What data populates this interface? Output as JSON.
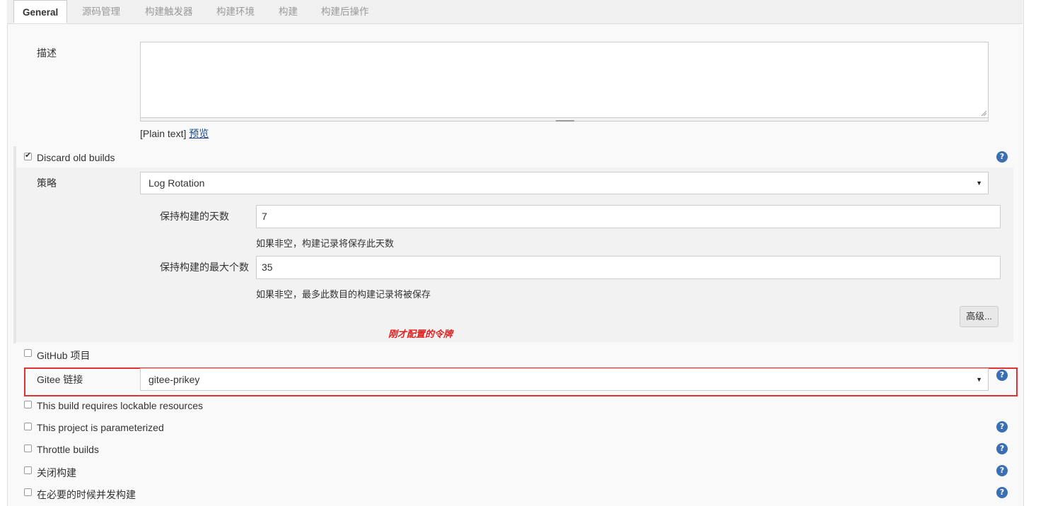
{
  "tabs": [
    {
      "label": "General",
      "active": true
    },
    {
      "label": "源码管理"
    },
    {
      "label": "构建触发器"
    },
    {
      "label": "构建环境"
    },
    {
      "label": "构建"
    },
    {
      "label": "构建后操作"
    }
  ],
  "description": {
    "label": "描述",
    "value": "",
    "format_label": "[Plain text]",
    "preview_link": "预览"
  },
  "discard_old_builds": {
    "label": "Discard old builds",
    "checked": true,
    "strategy_label": "策略",
    "strategy_value": "Log Rotation",
    "days_label": "保持构建的天数",
    "days_value": "7",
    "days_hint": "如果非空，构建记录将保存此天数",
    "max_label": "保持构建的最大个数",
    "max_value": "35",
    "max_hint": "如果非空，最多此数目的构建记录将被保存",
    "advanced_button": "高级..."
  },
  "annotation": "刚才配置的令牌",
  "github_project": {
    "label": "GitHub 项目",
    "checked": false
  },
  "gitee": {
    "label": "Gitee 链接",
    "value": "gitee-prikey"
  },
  "options": [
    {
      "label": "This build requires lockable resources",
      "checked": false,
      "help": false
    },
    {
      "label": "This project is parameterized",
      "checked": false,
      "help": true
    },
    {
      "label": "Throttle builds",
      "checked": false,
      "help": true
    },
    {
      "label": "关闭构建",
      "checked": false,
      "help": true
    },
    {
      "label": "在必要的时候并发构建",
      "checked": false,
      "help": true
    }
  ],
  "help_icon_text": "?",
  "dropdown_arrow": "▼",
  "colors": {
    "accent": "#3a6fb3",
    "highlight": "#dd3333",
    "annotation": "#e02020"
  }
}
